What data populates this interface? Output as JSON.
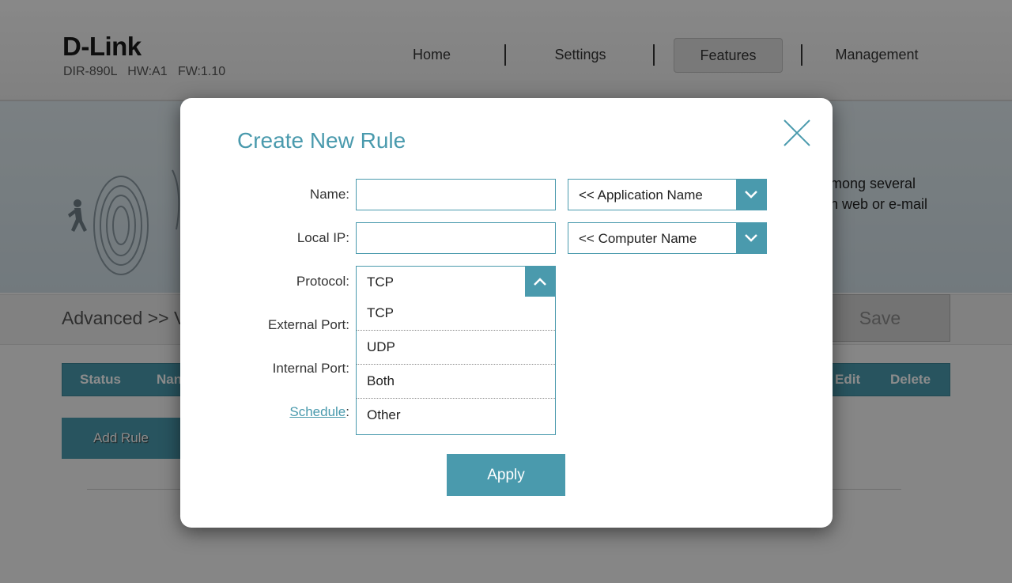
{
  "header": {
    "logo": "D-Link",
    "model": "DIR-890L",
    "hw": "HW:A1",
    "fw": "FW:1.10",
    "nav": [
      {
        "label": "Home"
      },
      {
        "label": "Settings"
      },
      {
        "label": "Features"
      },
      {
        "label": "Management"
      }
    ],
    "active_nav": "Features"
  },
  "banner": {
    "line1": "mong several",
    "line2": "n web or e-mail"
  },
  "page": {
    "breadcrumb": "Advanced >> V",
    "save_label": "Save",
    "table_headers": {
      "status": "Status",
      "name": "Nan",
      "edit": "Edit",
      "delete": "Delete"
    },
    "add_rule_label": "Add Rule"
  },
  "modal": {
    "title": "Create New Rule",
    "name_label": "Name:",
    "local_ip_label": "Local IP:",
    "protocol_label": "Protocol:",
    "external_port_label": "External Port:",
    "internal_port_label": "Internal Port:",
    "schedule_label": "Schedule",
    "schedule_colon": ":",
    "name_value": "",
    "local_ip_value": "",
    "application_select": "<< Application Name",
    "computer_select": "<< Computer Name",
    "protocol_selected": "TCP",
    "protocol_options": [
      "TCP",
      "UDP",
      "Both",
      "Other"
    ],
    "apply_label": "Apply"
  },
  "colors": {
    "accent": "#4a9aad",
    "title": "#4a9aad"
  }
}
